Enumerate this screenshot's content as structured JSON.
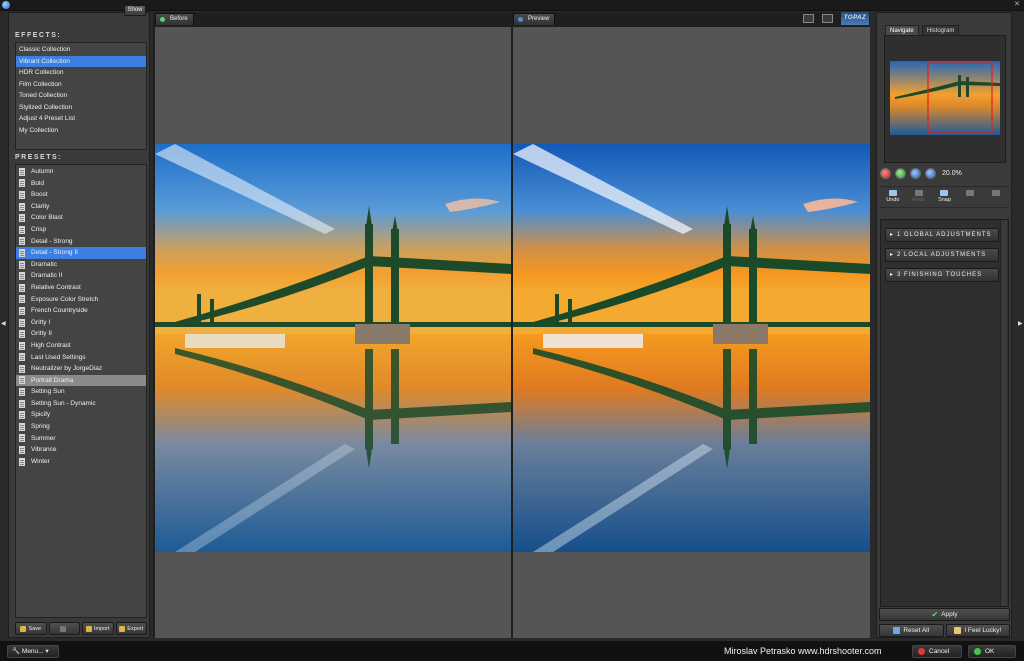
{
  "titlebar": {
    "title": ""
  },
  "left": {
    "show_button": "Show",
    "effects_label": "EFFECTS:",
    "effects": [
      {
        "label": "Classic Collection",
        "selected": false
      },
      {
        "label": "Vibrant Collection",
        "selected": true
      },
      {
        "label": "HDR Collection",
        "selected": false
      },
      {
        "label": "Film Collection",
        "selected": false
      },
      {
        "label": "Toned Collection",
        "selected": false
      },
      {
        "label": "Stylized Collection",
        "selected": false
      },
      {
        "label": "Adjust 4 Preset List",
        "selected": false
      },
      {
        "label": "My Collection",
        "selected": false
      }
    ],
    "presets_label": "PRESETS:",
    "presets": [
      {
        "label": "Autumn",
        "state": ""
      },
      {
        "label": "Bold",
        "state": ""
      },
      {
        "label": "Boost",
        "state": ""
      },
      {
        "label": "Clarity",
        "state": ""
      },
      {
        "label": "Color Blast",
        "state": ""
      },
      {
        "label": "Crisp",
        "state": ""
      },
      {
        "label": "Detail - Strong",
        "state": ""
      },
      {
        "label": "Detail - Strong II",
        "state": "selected"
      },
      {
        "label": "Dramatic",
        "state": ""
      },
      {
        "label": "Dramatic II",
        "state": ""
      },
      {
        "label": "Relative Contrast",
        "state": ""
      },
      {
        "label": "Exposure Color Stretch",
        "state": ""
      },
      {
        "label": "French Countryside",
        "state": ""
      },
      {
        "label": "Gritty I",
        "state": ""
      },
      {
        "label": "Gritty II",
        "state": ""
      },
      {
        "label": "High Contrast",
        "state": ""
      },
      {
        "label": "Last Used Settings",
        "state": ""
      },
      {
        "label": "Neutralizer by JorgeDiaz",
        "state": ""
      },
      {
        "label": "Portrait Drama",
        "state": "hover"
      },
      {
        "label": "Setting Sun",
        "state": ""
      },
      {
        "label": "Setting Sun - Dynamic",
        "state": ""
      },
      {
        "label": "Spicify",
        "state": ""
      },
      {
        "label": "Spring",
        "state": ""
      },
      {
        "label": "Summer",
        "state": ""
      },
      {
        "label": "Vibrance",
        "state": ""
      },
      {
        "label": "Winter",
        "state": ""
      }
    ],
    "actions": {
      "save": "Save",
      "disabled": "",
      "import": "Import",
      "export": "Export"
    }
  },
  "center": {
    "before_tab": "Before",
    "preview_tab": "Preview",
    "logo": "TOPAZ"
  },
  "right": {
    "tab_navigate": "Navigate",
    "tab_histogram": "Histogram",
    "zoom_level": "20.0%",
    "history": {
      "undo": "Undo",
      "redo": "Redo",
      "snap": "Snap",
      "b4": "",
      "b5": ""
    },
    "adjustments": [
      "1 GLOBAL ADJUSTMENTS",
      "2 LOCAL ADJUSTMENTS",
      "3 FINISHING TOUCHES"
    ],
    "apply": "Apply",
    "reset_all": "Reset All",
    "feel_lucky": "I Feel Lucky!"
  },
  "bottom": {
    "menu": "Menu...",
    "credit": "Miroslav  Petrasko  www.hdrshooter.com",
    "cancel": "Cancel",
    "ok": "OK"
  }
}
